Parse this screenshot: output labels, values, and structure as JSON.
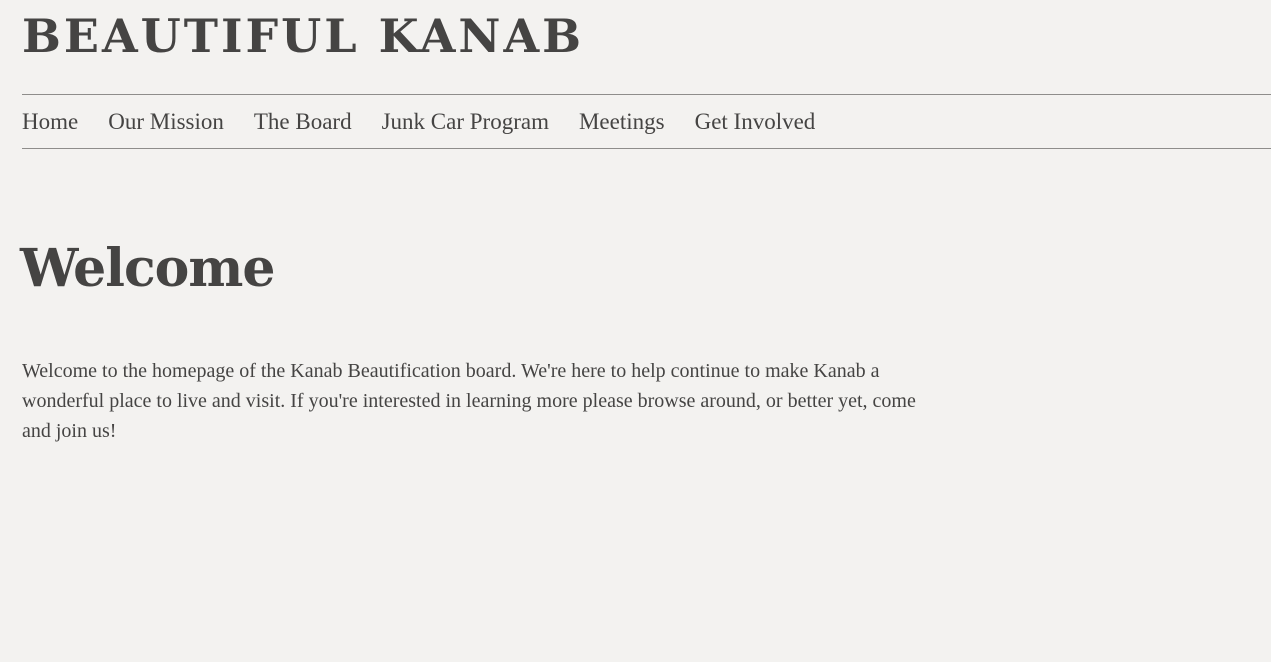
{
  "site": {
    "title": "BEAUTIFUL KANAB"
  },
  "nav": {
    "items": [
      {
        "label": "Home"
      },
      {
        "label": "Our Mission"
      },
      {
        "label": "The Board"
      },
      {
        "label": "Junk Car Program"
      },
      {
        "label": "Meetings"
      },
      {
        "label": "Get Involved"
      }
    ]
  },
  "main": {
    "heading": "Welcome",
    "body": "Welcome to the homepage of the Kanab Beautification board. We're here to help continue to make Kanab a wonderful place to live and visit. If you're interested in learning more please browse around, or better yet, come and join us!"
  },
  "colors": {
    "background": "#f3f2f0",
    "text": "#454443",
    "rule": "#8e8d8b"
  }
}
